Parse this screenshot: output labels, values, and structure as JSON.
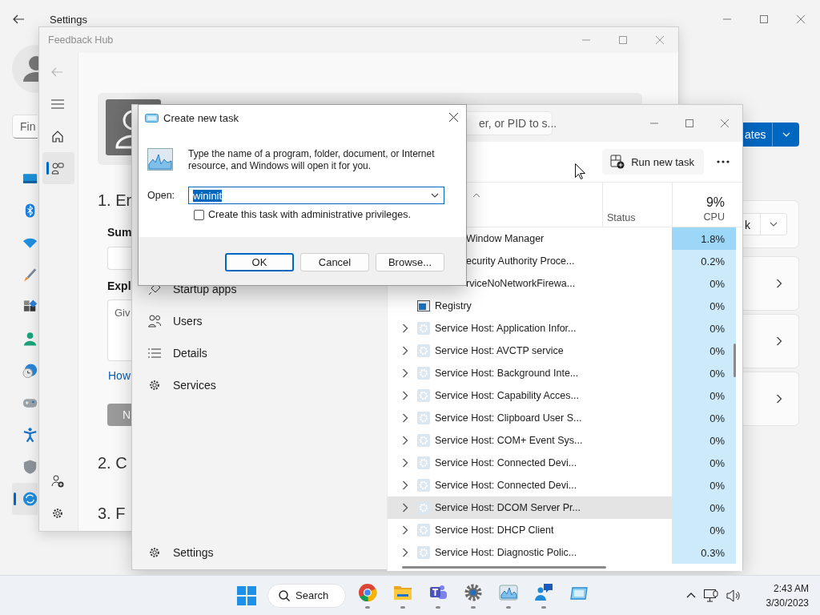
{
  "settings_window": {
    "title": "Settings",
    "search": {
      "placeholder": "Fin"
    },
    "nav": [
      {
        "selected": false
      },
      {
        "selected": false
      },
      {
        "selected": false
      },
      {
        "selected": false
      },
      {
        "selected": false
      },
      {
        "selected": false
      },
      {
        "selected": false
      },
      {
        "selected": false
      },
      {
        "selected": false
      },
      {
        "selected": false
      },
      {
        "selected": true
      }
    ],
    "primary_button": {
      "label": "ates"
    },
    "cards": [
      {
        "kind": "dropdown",
        "value": "k"
      },
      {
        "kind": "link"
      },
      {
        "kind": "link"
      },
      {
        "kind": "link"
      }
    ]
  },
  "feedback_hub": {
    "title": "Feedback Hub",
    "back_button": {
      "disabled": true
    },
    "nav": [
      {
        "selected": false
      },
      {
        "selected": true
      }
    ],
    "step_1_heading": "1. Er",
    "summary_label": "Sum",
    "details_label": "Expl",
    "details_placeholder": "Giv",
    "help_link": "How",
    "next_button": {
      "label": "N",
      "disabled": true
    },
    "step_2_heading": "2. C",
    "step_3_heading": "3. F"
  },
  "task_manager": {
    "search": {
      "placeholder": "er, or PID to s..."
    },
    "nav": [
      {
        "label": "Startup apps",
        "selected": false
      },
      {
        "label": "Users",
        "selected": false
      },
      {
        "label": "Details",
        "selected": false
      },
      {
        "label": "Services",
        "selected": false
      }
    ],
    "nav_footer": {
      "label": "Settings"
    },
    "run_new_task": "Run new task",
    "columns": {
      "status": "Status",
      "cpu_total": "9%",
      "cpu": "CPU"
    },
    "rows": [
      {
        "kind": "clipped",
        "name": "Window Manager",
        "cpu": "1.8%",
        "color": "#9dd7f7",
        "hovered": false
      },
      {
        "kind": "clipped",
        "name": "ecurity Authority Proce...",
        "cpu": "0.2%",
        "color": "#cdeafb",
        "hovered": false
      },
      {
        "kind": "clipped",
        "name": "rviceNoNetworkFirewa...",
        "cpu": "0%",
        "color": "#cdeafb",
        "hovered": false
      },
      {
        "kind": "process",
        "name": "Registry",
        "cpu": "0%",
        "color": "#cdeafb",
        "hovered": false
      },
      {
        "kind": "service",
        "name": "Service Host: Application Infor...",
        "cpu": "0%",
        "color": "#cdeafb",
        "hovered": false
      },
      {
        "kind": "service",
        "name": "Service Host: AVCTP service",
        "cpu": "0%",
        "color": "#cdeafb",
        "hovered": false
      },
      {
        "kind": "service",
        "name": "Service Host: Background Inte...",
        "cpu": "0%",
        "color": "#cdeafb",
        "hovered": false
      },
      {
        "kind": "service",
        "name": "Service Host: Capability Acces...",
        "cpu": "0%",
        "color": "#cdeafb",
        "hovered": false
      },
      {
        "kind": "service",
        "name": "Service Host: Clipboard User S...",
        "cpu": "0%",
        "color": "#cdeafb",
        "hovered": false
      },
      {
        "kind": "service",
        "name": "Service Host: COM+ Event Sys...",
        "cpu": "0%",
        "color": "#cdeafb",
        "hovered": false
      },
      {
        "kind": "service",
        "name": "Service Host: Connected Devi...",
        "cpu": "0%",
        "color": "#cdeafb",
        "hovered": false
      },
      {
        "kind": "service",
        "name": "Service Host: Connected Devi...",
        "cpu": "0%",
        "color": "#cdeafb",
        "hovered": false
      },
      {
        "kind": "service",
        "name": "Service Host: DCOM Server Pr...",
        "cpu": "0%",
        "color": "#cdeafb",
        "hovered": true
      },
      {
        "kind": "service",
        "name": "Service Host: DHCP Client",
        "cpu": "0%",
        "color": "#cdeafb",
        "hovered": false
      },
      {
        "kind": "service",
        "name": "Service Host: Diagnostic Polic...",
        "cpu": "0.3%",
        "color": "#cdeafb",
        "hovered": false
      }
    ]
  },
  "dialog": {
    "title": "Create new task",
    "message": "Type the name of a program, folder, document, or Internet resource, and Windows will open it for you.",
    "open_label": "Open:",
    "open_value": "wininit",
    "value_selected": true,
    "admin_checkbox": {
      "label": "Create this task with administrative privileges.",
      "checked": false
    },
    "buttons": [
      {
        "label": "OK",
        "default": true
      },
      {
        "label": "Cancel",
        "default": false
      },
      {
        "label": "Browse...",
        "default": false
      }
    ]
  },
  "taskbar": {
    "search": "Search",
    "apps": [
      {
        "running": true
      },
      {
        "running": true
      },
      {
        "running": true
      },
      {
        "running": true
      },
      {
        "running": true
      },
      {
        "running": true
      },
      {
        "running": false
      }
    ],
    "time": "2:43 AM",
    "date": "3/30/2023"
  }
}
